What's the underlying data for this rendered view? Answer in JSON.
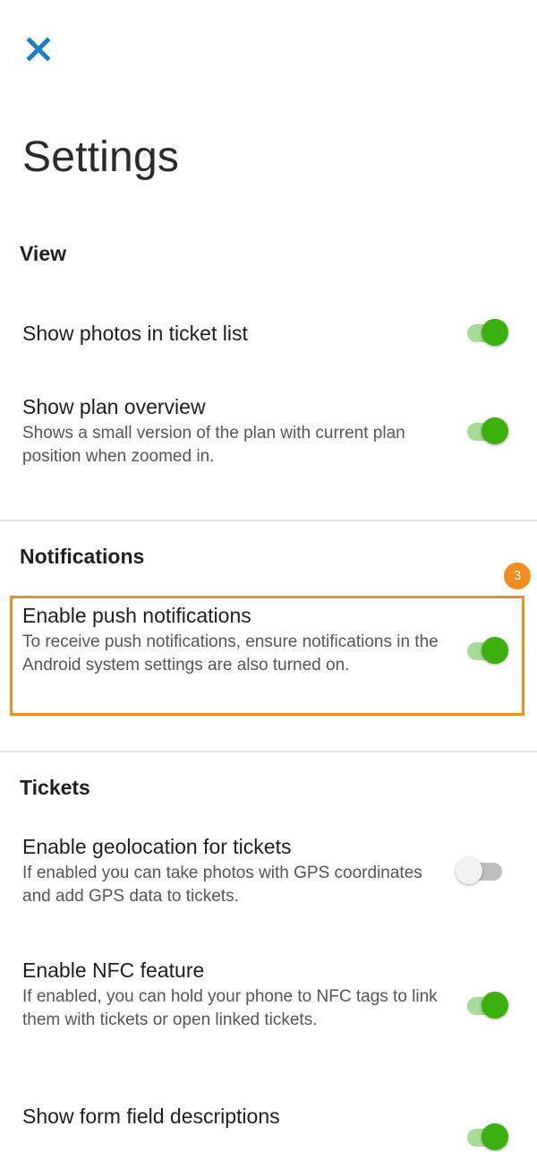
{
  "header": {
    "close_icon": "close-icon",
    "title": "Settings"
  },
  "colors": {
    "accent": "#1a7fc9",
    "toggle_on": "#3cb10e",
    "highlight": "#f28c1c"
  },
  "sections": [
    {
      "label": "View",
      "items": [
        {
          "title": "Show photos in ticket list",
          "description": "",
          "enabled": true
        },
        {
          "title": "Show plan overview",
          "description": "Shows a small version of the plan with current plan position when zoomed in.",
          "enabled": true
        }
      ]
    },
    {
      "label": "Notifications",
      "items": [
        {
          "title": "Enable push notifications",
          "description": "To receive push notifications, ensure notifications in the Android system settings are also turned on.",
          "enabled": true
        }
      ]
    },
    {
      "label": "Tickets",
      "items": [
        {
          "title": "Enable geolocation for tickets",
          "description": "If enabled you can take photos with GPS coordinates and add GPS data to tickets.",
          "enabled": false
        },
        {
          "title": "Enable NFC feature",
          "description": "If enabled, you can hold your phone to NFC tags to link them with tickets or open linked tickets.",
          "enabled": true
        },
        {
          "title": "Show form field descriptions",
          "description": "",
          "enabled": true
        }
      ]
    }
  ],
  "annotation": {
    "step_badge": "3"
  }
}
